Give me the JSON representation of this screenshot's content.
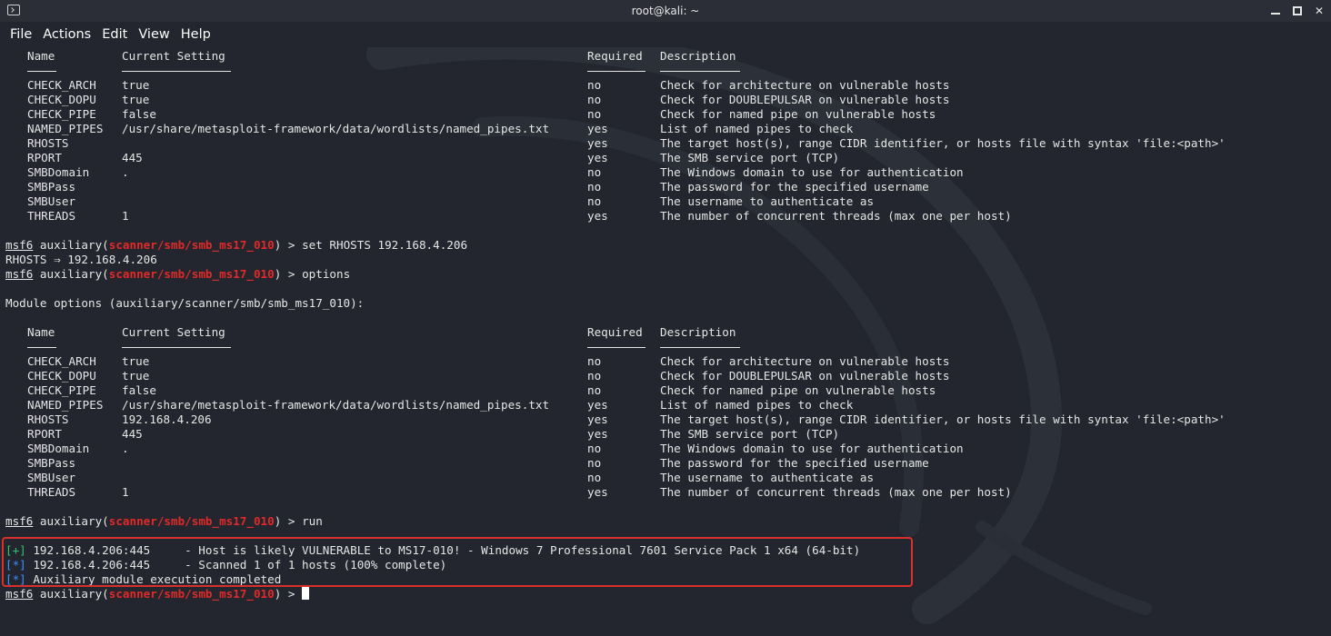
{
  "window": {
    "title": "root@kali: ~"
  },
  "menu": [
    "File",
    "Actions",
    "Edit",
    "View",
    "Help"
  ],
  "headers": {
    "name": "Name",
    "setting": "Current Setting",
    "required": "Required",
    "description": "Description"
  },
  "table1": [
    [
      "CHECK_ARCH",
      "true",
      "no",
      "Check for architecture on vulnerable hosts"
    ],
    [
      "CHECK_DOPU",
      "true",
      "no",
      "Check for DOUBLEPULSAR on vulnerable hosts"
    ],
    [
      "CHECK_PIPE",
      "false",
      "no",
      "Check for named pipe on vulnerable hosts"
    ],
    [
      "NAMED_PIPES",
      "/usr/share/metasploit-framework/data/wordlists/named_pipes.txt",
      "yes",
      "List of named pipes to check"
    ],
    [
      "RHOSTS",
      "",
      "yes",
      "The target host(s), range CIDR identifier, or hosts file with syntax 'file:<path>'"
    ],
    [
      "RPORT",
      "445",
      "yes",
      "The SMB service port (TCP)"
    ],
    [
      "SMBDomain",
      ".",
      "no",
      "The Windows domain to use for authentication"
    ],
    [
      "SMBPass",
      "",
      "no",
      "The password for the specified username"
    ],
    [
      "SMBUser",
      "",
      "no",
      "The username to authenticate as"
    ],
    [
      "THREADS",
      "1",
      "yes",
      "The number of concurrent threads (max one per host)"
    ]
  ],
  "table2": [
    [
      "CHECK_ARCH",
      "true",
      "no",
      "Check for architecture on vulnerable hosts"
    ],
    [
      "CHECK_DOPU",
      "true",
      "no",
      "Check for DOUBLEPULSAR on vulnerable hosts"
    ],
    [
      "CHECK_PIPE",
      "false",
      "no",
      "Check for named pipe on vulnerable hosts"
    ],
    [
      "NAMED_PIPES",
      "/usr/share/metasploit-framework/data/wordlists/named_pipes.txt",
      "yes",
      "List of named pipes to check"
    ],
    [
      "RHOSTS",
      "192.168.4.206",
      "yes",
      "The target host(s), range CIDR identifier, or hosts file with syntax 'file:<path>'"
    ],
    [
      "RPORT",
      "445",
      "yes",
      "The SMB service port (TCP)"
    ],
    [
      "SMBDomain",
      ".",
      "no",
      "The Windows domain to use for authentication"
    ],
    [
      "SMBPass",
      "",
      "no",
      "The password for the specified username"
    ],
    [
      "SMBUser",
      "",
      "no",
      "The username to authenticate as"
    ],
    [
      "THREADS",
      "1",
      "yes",
      "The number of concurrent threads (max one per host)"
    ]
  ],
  "prompt": {
    "msf": "msf6",
    "pre": " auxiliary(",
    "module": "scanner/smb/smb_ms17_010",
    "post": ") > "
  },
  "commands": {
    "set": "set RHOSTS 192.168.4.206",
    "options": "options",
    "run": "run"
  },
  "set_result": "RHOSTS ⇒ 192.168.4.206",
  "module_options_title": "Module options (auxiliary/scanner/smb/smb_ms17_010):",
  "results": [
    {
      "tag": "[+]",
      "text": " 192.168.4.206:445     - Host is likely VULNERABLE to MS17-010! - Windows 7 Professional 7601 Service Pack 1 x64 (64-bit)"
    },
    {
      "tag": "[*]",
      "text": " 192.168.4.206:445     - Scanned 1 of 1 hosts (100% complete)"
    },
    {
      "tag": "[*]",
      "text": " Auxiliary module execution completed"
    }
  ],
  "colors": {
    "background": "#23262e",
    "module": "#e02a2a",
    "success": "#2fc46d",
    "info": "#3d8fff",
    "highlight_border": "#d9302c"
  }
}
